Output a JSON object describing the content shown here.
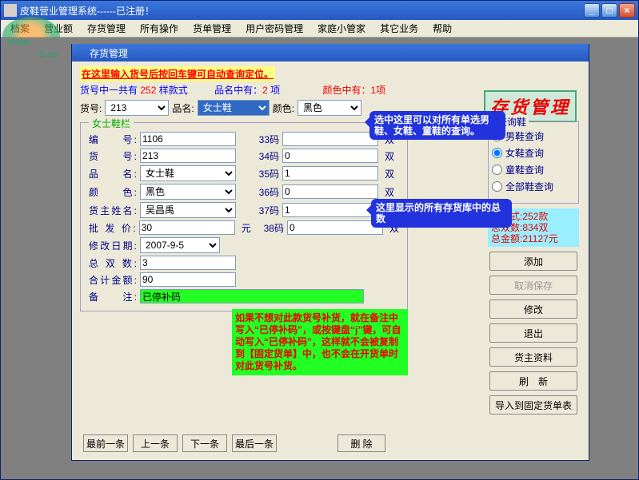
{
  "app": {
    "title": "皮鞋营业管理系统------已注册！",
    "watermark": "www",
    "watermark2": "9.cn"
  },
  "menu": [
    "档案",
    "营业额",
    "存货管理",
    "所有操作",
    "货单管理",
    "用户密码管理",
    "家庭小管家",
    "其它业务",
    "帮助"
  ],
  "dialog": {
    "title": "存货管理"
  },
  "notes": {
    "top_hint": "在这里输入货号后按回车键可自动查询定位。",
    "callout1": "选中这里可以对所有单选男鞋、女鞋、童鞋的查询。",
    "callout2": "这里显示的所有存货库中的总数",
    "green": "如果不想对此款货号补货，就在备注中写入“已停补码”，或按键盘“j”键，可自动写入“已停补码”，这样就不会被复制到【固定货单】中，也不会在开货单时对此货号补货。"
  },
  "stats": {
    "line": "货号中一共有 252 样款式　　　品名中有：2 项　　　　　颜色中有：1项",
    "count_styles": "252",
    "count_pinming": "2",
    "count_color": "1"
  },
  "filters": {
    "huohao_label": "货号:",
    "huohao_value": "213",
    "pinming_label": "品名:",
    "pinming_value": "女士鞋",
    "yanse_label": "颜色:",
    "yanse_value": "黑色"
  },
  "big_title": "存货管理",
  "fieldset": {
    "legend": "女士鞋栏",
    "rows": {
      "bianhao": {
        "label": "编　　号:",
        "value": "1106"
      },
      "huohao": {
        "label": "货　　号:",
        "value": "213"
      },
      "pinming": {
        "label": "品　　名:",
        "value": "女士鞋"
      },
      "yanse": {
        "label": "颜　　色:",
        "value": "黑色"
      },
      "huozhu": {
        "label": "货主姓名:",
        "value": "吴昌禹"
      },
      "pifa": {
        "label": "批 发 价:",
        "value": "30",
        "unit": "元"
      },
      "xiugai": {
        "label": "修改日期:",
        "value": "2007-9-5"
      },
      "zongshuang": {
        "label": "总 双 数:",
        "value": "3"
      },
      "heji": {
        "label": "合计金额:",
        "value": "90"
      },
      "beizhu": {
        "label": "备　　注:",
        "value": "已停补码"
      }
    },
    "sizes": [
      {
        "label": "33码",
        "value": "",
        "unit": "双"
      },
      {
        "label": "34码",
        "value": "0",
        "unit": "双"
      },
      {
        "label": "35码",
        "value": "1",
        "unit": "双"
      },
      {
        "label": "36码",
        "value": "0",
        "unit": "双"
      },
      {
        "label": "37码",
        "value": "1",
        "unit": "双"
      },
      {
        "label": "38码",
        "value": "0",
        "unit": "双"
      }
    ]
  },
  "query": {
    "legend": "查询鞋",
    "opts": [
      "男鞋查询",
      "女鞋查询",
      "童鞋查询",
      "全部鞋查询"
    ],
    "selected": 1
  },
  "totals": {
    "a": "总款式:252款",
    "b": "总双数:834双",
    "c": "总金额:21127元"
  },
  "buttons": {
    "add": "添加",
    "cancel": "取消保存",
    "edit": "修改",
    "exit": "退出",
    "owner": "货主资料",
    "refresh": "刷　新",
    "export": "导入到固定货单表",
    "first": "最前一条",
    "prev": "上一条",
    "next": "下一条",
    "last": "最后一条",
    "delete": "删 除"
  }
}
